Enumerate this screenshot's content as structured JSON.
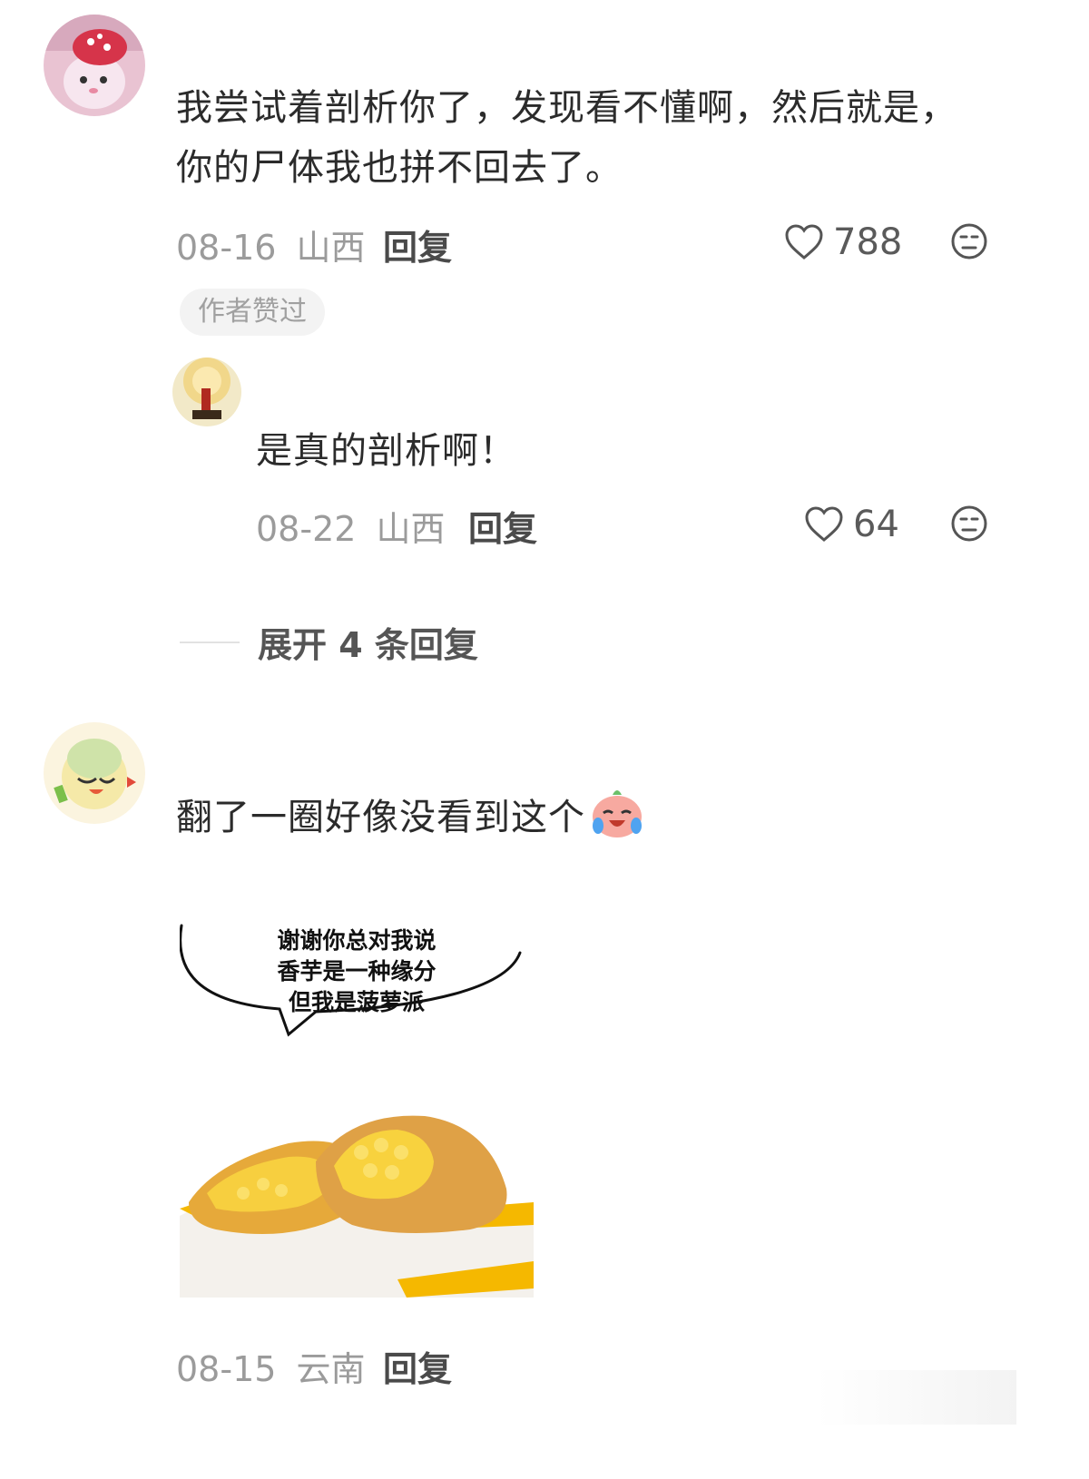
{
  "comments": [
    {
      "text_line1": "我尝试着剖析你了，发现看不懂啊，然后就是，",
      "text_line2": "你的尸体我也拼不回去了。",
      "date": "08-16",
      "location": "山西",
      "reply_label": "回复",
      "likes": "788",
      "badge": "作者赞过",
      "replies": [
        {
          "text": "是真的剖析啊！",
          "date": "08-22",
          "location": "山西",
          "reply_label": "回复",
          "likes": "64"
        }
      ],
      "expand_label": "展开 4 条回复"
    },
    {
      "text": "翻了一圈好像没看到这个",
      "emoji": "crying-laughing-peach-emoji",
      "image": {
        "caption_line1": "谢谢你总对我说",
        "caption_line2": "香芋是一种缘分",
        "caption_line3": "但我是菠萝派"
      },
      "date": "08-15",
      "location": "云南",
      "reply_label": "回复"
    }
  ],
  "colors": {
    "text": "#2b2b2b",
    "meta": "#9b9b9b",
    "badge_bg": "#f3f3f3",
    "pie_yellow": "#f5b800"
  }
}
